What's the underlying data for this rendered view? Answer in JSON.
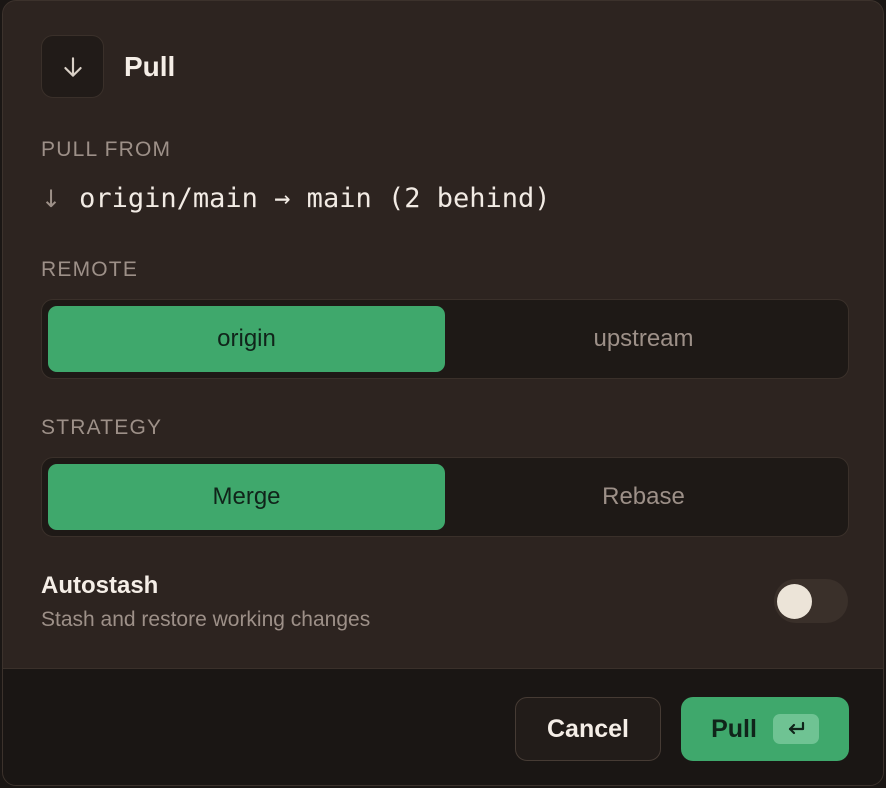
{
  "dialog": {
    "title": "Pull",
    "header_icon": "arrow-down-icon"
  },
  "pull_from": {
    "label": "PULL FROM",
    "arrow": "↓",
    "value": "origin/main → main (2 behind)"
  },
  "remote": {
    "label": "REMOTE",
    "options": [
      {
        "label": "origin",
        "selected": true
      },
      {
        "label": "upstream",
        "selected": false
      }
    ]
  },
  "strategy": {
    "label": "STRATEGY",
    "options": [
      {
        "label": "Merge",
        "selected": true
      },
      {
        "label": "Rebase",
        "selected": false
      }
    ]
  },
  "autostash": {
    "title": "Autostash",
    "description": "Stash and restore working changes",
    "enabled": false
  },
  "footer": {
    "cancel_label": "Cancel",
    "pull_label": "Pull",
    "pull_shortcut": "↵"
  },
  "colors": {
    "accent": "#3fa86c",
    "background": "#2d2420"
  }
}
